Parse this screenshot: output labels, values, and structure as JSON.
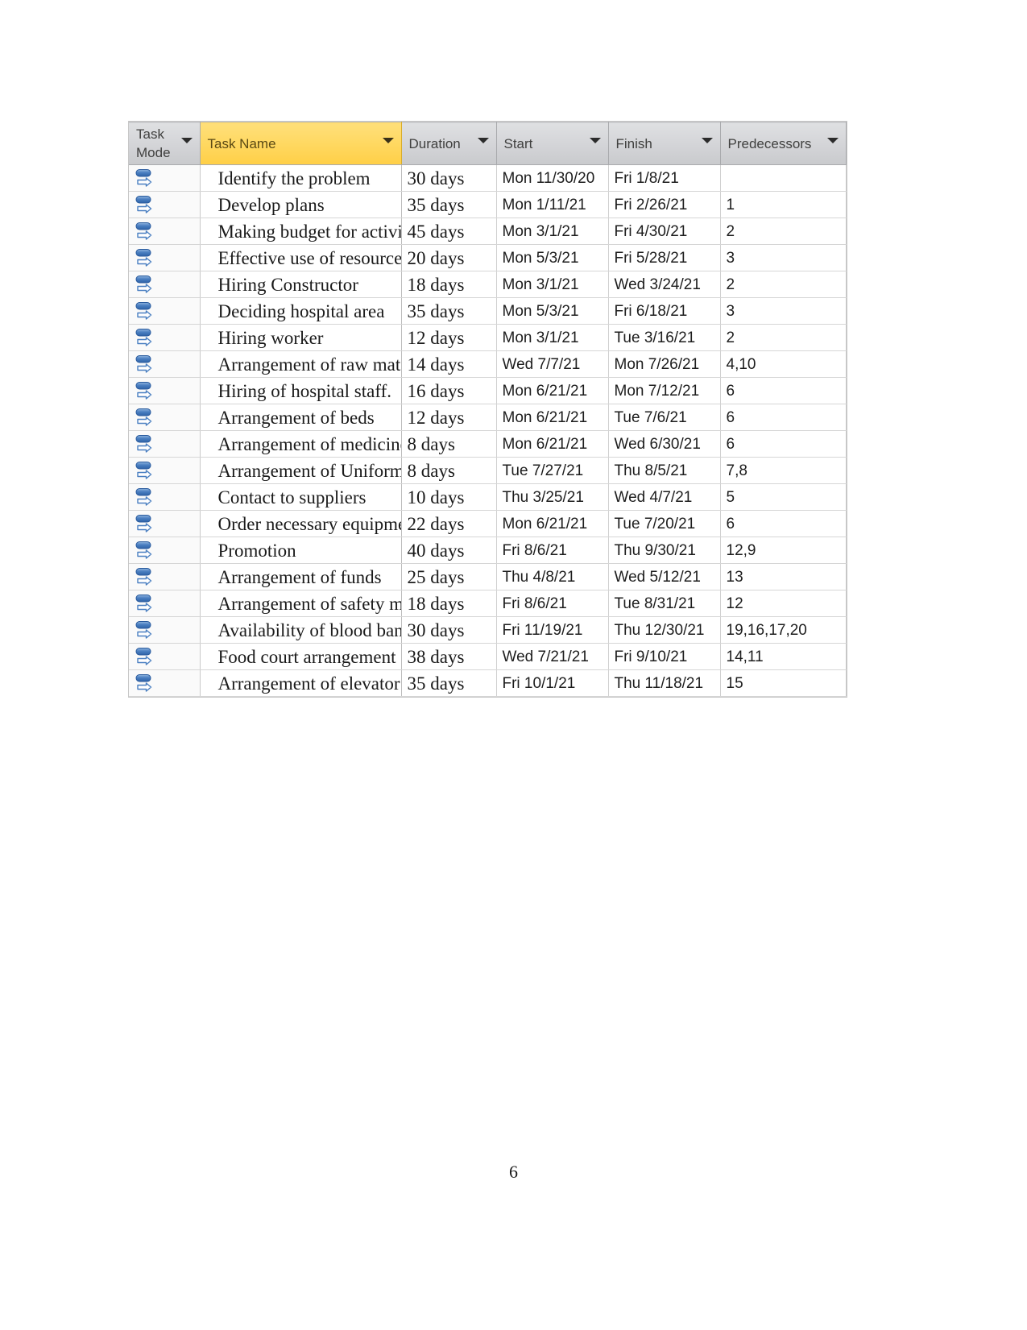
{
  "document": {
    "page_number": "6"
  },
  "table": {
    "columns": [
      {
        "label": "Task Mode",
        "key": "task_mode",
        "has_filter_arrow": true
      },
      {
        "label": "Task Name",
        "key": "task_name",
        "has_filter_arrow": true,
        "highlighted": true,
        "highlight_color": "#ffd964"
      },
      {
        "label": "Duration",
        "key": "duration",
        "has_filter_arrow": true
      },
      {
        "label": "Start",
        "key": "start",
        "has_filter_arrow": true
      },
      {
        "label": "Finish",
        "key": "finish",
        "has_filter_arrow": true
      },
      {
        "label": "Predecessors",
        "key": "predecessors",
        "has_filter_arrow": true
      }
    ],
    "task_mode_icon": "auto-scheduled-icon",
    "rows": [
      {
        "task_mode": "auto-scheduled-icon",
        "task_name": "Identify the problem",
        "duration": "30 days",
        "start": "Mon 11/30/20",
        "finish": "Fri 1/8/21",
        "predecessors": ""
      },
      {
        "task_mode": "auto-scheduled-icon",
        "task_name": "Develop plans",
        "duration": "35 days",
        "start": "Mon 1/11/21",
        "finish": "Fri 2/26/21",
        "predecessors": "1"
      },
      {
        "task_mode": "auto-scheduled-icon",
        "task_name": "Making budget for activit",
        "duration": "45 days",
        "start": "Mon 3/1/21",
        "finish": "Fri 4/30/21",
        "predecessors": "2"
      },
      {
        "task_mode": "auto-scheduled-icon",
        "task_name": "Effective use of resource",
        "duration": "20 days",
        "start": "Mon 5/3/21",
        "finish": "Fri 5/28/21",
        "predecessors": "3"
      },
      {
        "task_mode": "auto-scheduled-icon",
        "task_name": "Hiring Constructor",
        "duration": "18 days",
        "start": "Mon 3/1/21",
        "finish": "Wed 3/24/21",
        "predecessors": "2"
      },
      {
        "task_mode": "auto-scheduled-icon",
        "task_name": "Deciding hospital area",
        "duration": "35 days",
        "start": "Mon 5/3/21",
        "finish": "Fri 6/18/21",
        "predecessors": "3"
      },
      {
        "task_mode": "auto-scheduled-icon",
        "task_name": "Hiring worker",
        "duration": "12 days",
        "start": "Mon 3/1/21",
        "finish": "Tue 3/16/21",
        "predecessors": "2"
      },
      {
        "task_mode": "auto-scheduled-icon",
        "task_name": "Arrangement of raw mate",
        "duration": "14 days",
        "start": "Wed 7/7/21",
        "finish": "Mon 7/26/21",
        "predecessors": "4,10"
      },
      {
        "task_mode": "auto-scheduled-icon",
        "task_name": "Hiring of hospital staff.",
        "duration": "16 days",
        "start": "Mon 6/21/21",
        "finish": "Mon 7/12/21",
        "predecessors": "6"
      },
      {
        "task_mode": "auto-scheduled-icon",
        "task_name": "Arrangement of beds",
        "duration": "12 days",
        "start": "Mon 6/21/21",
        "finish": "Tue 7/6/21",
        "predecessors": "6"
      },
      {
        "task_mode": "auto-scheduled-icon",
        "task_name": "Arrangement of medicine",
        "duration": "8 days",
        "start": "Mon 6/21/21",
        "finish": "Wed 6/30/21",
        "predecessors": "6"
      },
      {
        "task_mode": "auto-scheduled-icon",
        "task_name": "Arrangement of Uniform :",
        "duration": "8 days",
        "start": "Tue 7/27/21",
        "finish": "Thu 8/5/21",
        "predecessors": "7,8"
      },
      {
        "task_mode": "auto-scheduled-icon",
        "task_name": "Contact to suppliers",
        "duration": "10 days",
        "start": "Thu 3/25/21",
        "finish": "Wed 4/7/21",
        "predecessors": "5"
      },
      {
        "task_mode": "auto-scheduled-icon",
        "task_name": "Order necessary equipme",
        "duration": "22 days",
        "start": "Mon 6/21/21",
        "finish": "Tue 7/20/21",
        "predecessors": "6"
      },
      {
        "task_mode": "auto-scheduled-icon",
        "task_name": "Promotion",
        "duration": "40 days",
        "start": "Fri 8/6/21",
        "finish": "Thu 9/30/21",
        "predecessors": "12,9"
      },
      {
        "task_mode": "auto-scheduled-icon",
        "task_name": "Arrangement of funds",
        "duration": "25 days",
        "start": "Thu 4/8/21",
        "finish": "Wed 5/12/21",
        "predecessors": "13"
      },
      {
        "task_mode": "auto-scheduled-icon",
        "task_name": "Arrangement of safety me",
        "duration": "18 days",
        "start": "Fri 8/6/21",
        "finish": "Tue 8/31/21",
        "predecessors": "12"
      },
      {
        "task_mode": "auto-scheduled-icon",
        "task_name": "Availability of blood bank",
        "duration": "30 days",
        "start": "Fri 11/19/21",
        "finish": "Thu 12/30/21",
        "predecessors": "19,16,17,20"
      },
      {
        "task_mode": "auto-scheduled-icon",
        "task_name": "Food court arrangement a",
        "duration": "38 days",
        "start": "Wed 7/21/21",
        "finish": "Fri 9/10/21",
        "predecessors": "14,11"
      },
      {
        "task_mode": "auto-scheduled-icon",
        "task_name": "Arrangement of elevator",
        "duration": "35 days",
        "start": "Fri 10/1/21",
        "finish": "Thu 11/18/21",
        "predecessors": "15"
      }
    ]
  }
}
